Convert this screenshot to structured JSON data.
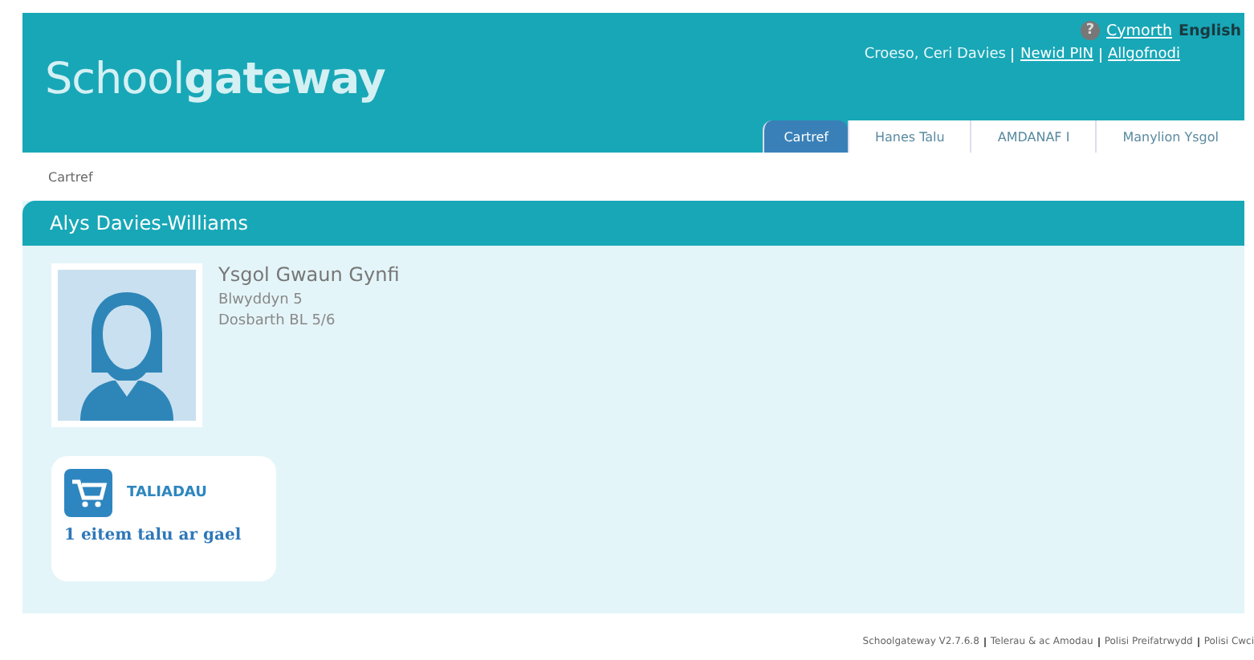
{
  "header": {
    "logo": "School**gateway**",
    "help_icon": "?",
    "help_link": "Cymorth",
    "language_link": "English",
    "welcome": "Croeso, Ceri Davies",
    "account_links": [
      "Newid PIN",
      "Allgofnodi"
    ]
  },
  "tabs": [
    {
      "label": "Cartref",
      "selected": true
    },
    {
      "label": "Hanes Talu",
      "selected": false
    },
    {
      "label": "AMDANAF I",
      "selected": false
    },
    {
      "label": "Manylion Ysgol",
      "selected": false
    }
  ],
  "breadcrumb": "Cartref",
  "student": {
    "name": "Alys Davies-Williams",
    "school": "Ysgol Gwaun Gynfi",
    "year": "Blwyddyn 5",
    "class": "Dosbarth BL 5/6"
  },
  "payments_card": {
    "title": "TALIADAU",
    "summary": "1 eitem talu ar gael"
  },
  "footer": {
    "version": "Schoolgateway V2.7.6.8",
    "links": [
      "Telerau & ac Amodau",
      "Polisi Preifatrwydd",
      "Polisi Cwci"
    ]
  }
}
